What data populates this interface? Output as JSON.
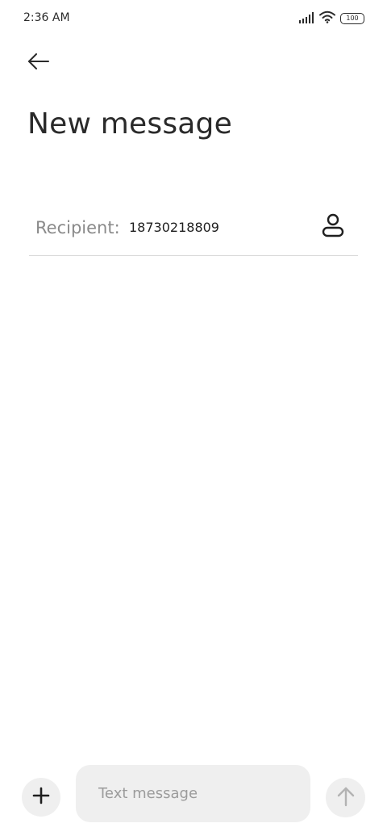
{
  "status_bar": {
    "time": "2:36 AM",
    "battery_level": "100",
    "icons": [
      "signal-icon",
      "wifi-icon",
      "battery-icon"
    ]
  },
  "header": {
    "back_icon": "back-arrow-icon",
    "title": "New message"
  },
  "recipient": {
    "label": "Recipient:",
    "value": "18730218809",
    "contact_icon": "contact-person-icon"
  },
  "composer": {
    "attach_icon": "plus-icon",
    "placeholder": "Text message",
    "send_icon": "send-arrow-up-icon"
  },
  "colors": {
    "text_primary": "#2a2a2a",
    "text_secondary": "#8a8a8a",
    "input_background": "#efefef",
    "divider": "#d9d9d9",
    "send_disabled": "#b3b3b3"
  }
}
